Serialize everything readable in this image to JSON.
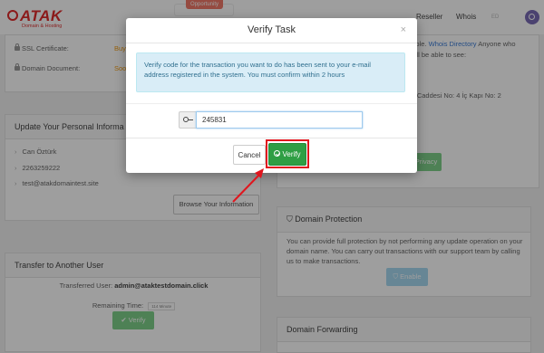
{
  "header": {
    "logo_text": "ATAK",
    "logo_sub": "Domain & Hosting",
    "opportunity": "Opportunity",
    "nav": {
      "reseller": "Reseller",
      "whois": "Whois",
      "lang": "ED"
    }
  },
  "left": {
    "ssl_label": "SSL Certificate:",
    "ssl_value": "Buy",
    "domain_doc_label": "Domain Document:",
    "domain_doc_value": "Soo",
    "personal": {
      "title": "Update Your Personal Informa",
      "items": [
        "Can Öztürk",
        "2263259222",
        "test@atakdomaintest.site"
      ],
      "browse_button": "Browse Your Information"
    },
    "transfer": {
      "title": "Transfer to Another User",
      "transferred_label": "Transferred User:",
      "transferred_value": "admin@ataktestdomain.click",
      "remaining_label": "Remaining Time:",
      "remaining_value": "114 Minute",
      "verify_label": "Verify"
    }
  },
  "right": {
    "whois_text_a": "sible.",
    "whois_link": "Whois Directory",
    "whois_text_b": "Anyone who",
    "whois_text_c": "vill be able to see:",
    "address": "k Caddesi No: 4 İç Kapı No: 2",
    "privacy_btn": "Privacy",
    "protection": {
      "title": "Domain Protection",
      "text": "You can provide full protection by not performing any update operation on your domain name. You can carry out transactions with our support team by calling us to make transactions.",
      "enable": "Enable"
    },
    "forwarding_title": "Domain Forwarding"
  },
  "modal": {
    "title": "Verify Task",
    "close": "×",
    "message": "Verify code for the transaction you want to do has been sent to your e-mail address registered in the system. You must confirm within 2 hours",
    "code_value": "245831",
    "cancel": "Cancel",
    "verify": "Verify"
  }
}
